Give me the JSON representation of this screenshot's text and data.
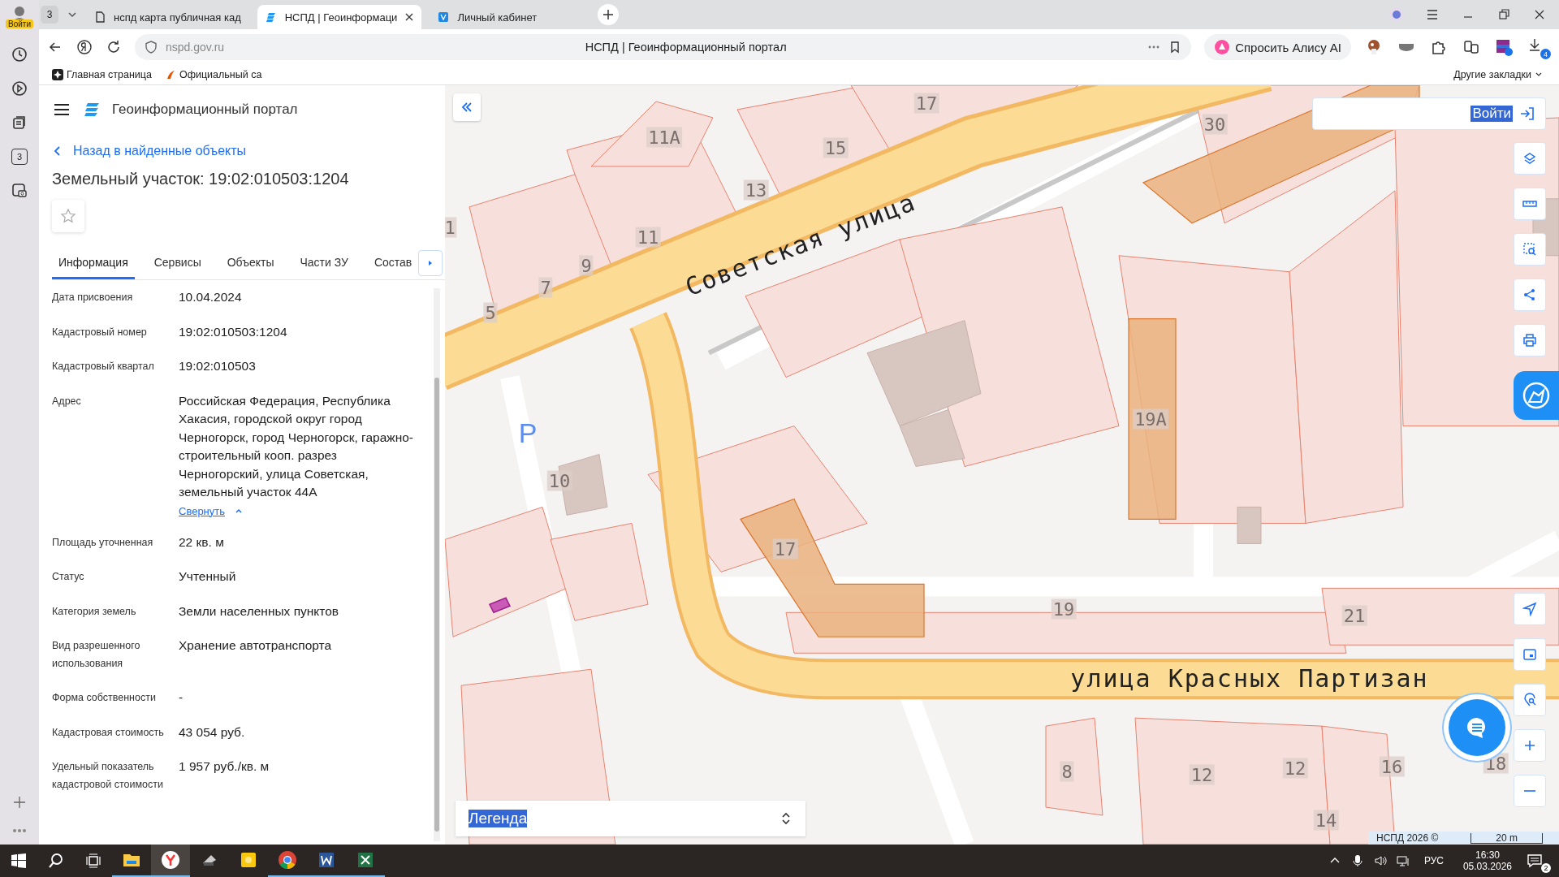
{
  "browser": {
    "profile_badge": "Войти",
    "tab_counter": "3",
    "sidebar_counter": "3",
    "tabs": [
      {
        "title": "нспд карта публичная кад",
        "selected": false
      },
      {
        "title": "НСПД | Геоинформаци",
        "selected": true
      },
      {
        "title": "Личный кабинет",
        "selected": false
      }
    ],
    "address": "nspd.gov.ru",
    "page_title": "НСПД | Геоинформационный портал",
    "alice_button": "Спросить Алису AI",
    "downloads_badge": "4",
    "bookmarks": [
      "Главная страница",
      "Официальный са"
    ],
    "other_bookmarks": "Другие закладки"
  },
  "panel": {
    "portal_title": "Геоинформационный портал",
    "back_link": "Назад в найденные объекты",
    "heading": "Земельный участок: 19:02:010503:1204",
    "tabs": [
      {
        "label": "Информация",
        "selected": true
      },
      {
        "label": "Сервисы",
        "selected": false
      },
      {
        "label": "Объекты",
        "selected": false
      },
      {
        "label": "Части ЗУ",
        "selected": false
      },
      {
        "label": "Состав",
        "selected": false
      }
    ],
    "fields": [
      {
        "label": "Дата присвоения",
        "value": "10.04.2024"
      },
      {
        "label": "Кадастровый номер",
        "value": "19:02:010503:1204"
      },
      {
        "label": "Кадастровый квартал",
        "value": "19:02:010503"
      },
      {
        "label": "Адрес",
        "value": "Российская Федерация, Республика Хакасия, городской округ город Черногорск, город Черногорск, гаражно-строительный кооп. разрез Черногорский, улица Советская, земельный участок 44А",
        "link": "Свернуть"
      },
      {
        "label": "Площадь уточненная",
        "value": "22 кв. м"
      },
      {
        "label": "Статус",
        "value": "Учтенный"
      },
      {
        "label": "Категория земель",
        "value": "Земли населенных пунктов"
      },
      {
        "label": "Вид разрешенного использования",
        "value": "Хранение автотранспорта"
      },
      {
        "label": "Форма собственности",
        "value": "-"
      },
      {
        "label": "Кадастровая стоимость",
        "value": "43 054 руб."
      },
      {
        "label": "Удельный показатель кадастровой стоимости",
        "value": "1 957 руб./кв. м"
      }
    ]
  },
  "map": {
    "login_button": "Войти",
    "legend": "Легенда",
    "attribution": "НСПД 2026 ©",
    "scale": "20 m",
    "labels": [
      {
        "text": "17",
        "kind": "house"
      },
      {
        "text": "30",
        "kind": "house"
      },
      {
        "text": "11А",
        "kind": "house"
      },
      {
        "text": "15",
        "kind": "house"
      },
      {
        "text": "13",
        "kind": "house"
      },
      {
        "text": "11",
        "kind": "house"
      },
      {
        "text": "9",
        "kind": "house"
      },
      {
        "text": "7",
        "kind": "house"
      },
      {
        "text": "5",
        "kind": "house"
      },
      {
        "text": "1",
        "kind": "house"
      },
      {
        "text": "Советская улица",
        "kind": "street"
      },
      {
        "text": "P",
        "kind": "parking"
      },
      {
        "text": "10",
        "kind": "house"
      },
      {
        "text": "19А",
        "kind": "house"
      },
      {
        "text": "17",
        "kind": "house"
      },
      {
        "text": "19",
        "kind": "house"
      },
      {
        "text": "21",
        "kind": "house"
      },
      {
        "text": "улица Красных Партизан",
        "kind": "street"
      },
      {
        "text": "8",
        "kind": "house"
      },
      {
        "text": "12",
        "kind": "house"
      },
      {
        "text": "12",
        "kind": "house"
      },
      {
        "text": "16",
        "kind": "house"
      },
      {
        "text": "18",
        "kind": "house"
      },
      {
        "text": "14",
        "kind": "house"
      }
    ]
  },
  "taskbar": {
    "apps": [
      {
        "kind": "explorer",
        "running": true,
        "selected": false
      },
      {
        "kind": "yandex",
        "running": true,
        "selected": true
      },
      {
        "kind": "scanner",
        "running": false,
        "selected": false
      },
      {
        "kind": "notes",
        "running": false,
        "selected": false
      },
      {
        "kind": "chrome",
        "running": true,
        "selected": false
      },
      {
        "kind": "word",
        "running": true,
        "selected": false
      },
      {
        "kind": "excel",
        "running": true,
        "selected": false
      }
    ],
    "language": "РУС",
    "time": "16:30",
    "date": "05.03.2026",
    "notifications": "2"
  }
}
